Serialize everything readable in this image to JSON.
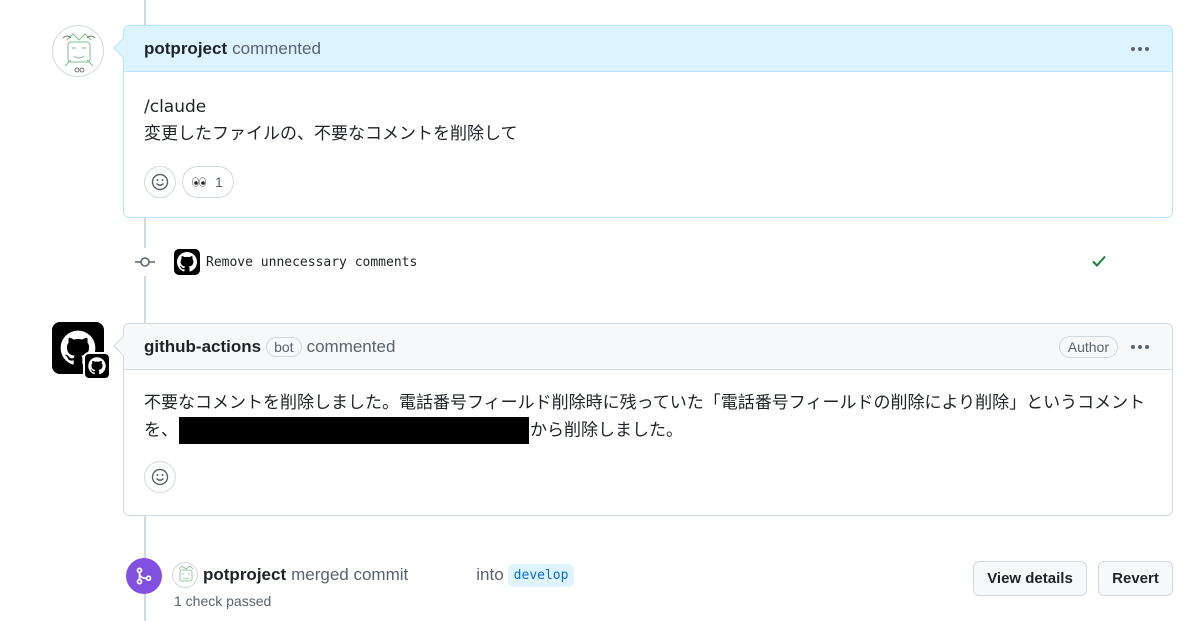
{
  "comment1": {
    "author": "potproject",
    "verb": "commented",
    "lines": [
      "/claude",
      "変更したファイルの、不要なコメントを削除して"
    ],
    "reaction_eyes_count": "1"
  },
  "commit": {
    "message": "Remove unnecessary comments",
    "status": "success"
  },
  "comment2": {
    "author": "github-actions",
    "bot_label": "bot",
    "verb": "commented",
    "author_label": "Author",
    "text_before": "不要なコメントを削除しました。電話番号フィールド削除時に残っていた「電話番号フィールドの削除により削除」というコメントを、",
    "text_after": "から削除しました。"
  },
  "merge": {
    "author": "potproject",
    "verb": "merged commit",
    "into_label": "into",
    "branch": "develop",
    "checks": "1 check passed",
    "view_details_label": "View details",
    "revert_label": "Revert"
  },
  "colors": {
    "accent_blue_bg": "#ddf4ff",
    "accent_blue_border": "#b6e3ff",
    "merged_purple": "#8250df",
    "success_green": "#1a7f37"
  }
}
